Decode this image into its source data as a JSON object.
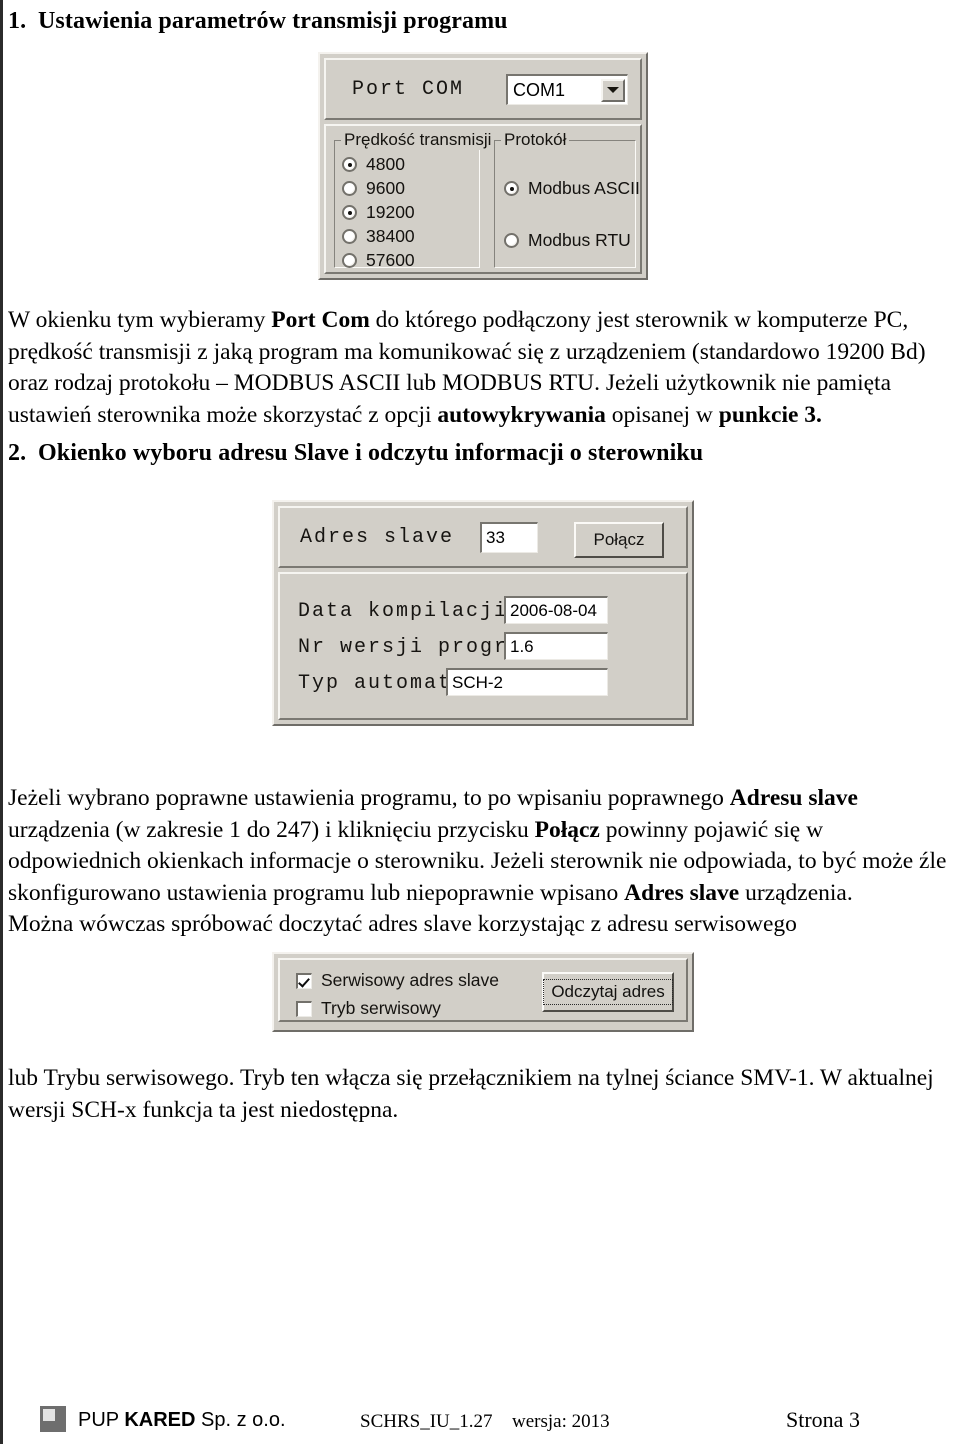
{
  "document": {
    "sections": [
      {
        "number": "1.",
        "title": "Ustawienia parametrów transmisji programu"
      },
      {
        "number": "2.",
        "title": "Okienko wyboru adresu Slave i odczytu informacji o sterowniku"
      }
    ],
    "paragraphs": {
      "p1_l1_a": "W okienku tym wybieramy ",
      "p1_l1_b": "Port Com",
      "p1_l1_c": " do którego podłączony jest sterownik w komputerze PC,",
      "p1_l2": "prędkość transmisji z jaką program ma komunikować się z urządzeniem (standardowo 19200 Bd)",
      "p1_l3": "oraz rodzaj protokołu – MODBUS ASCII lub MODBUS RTU. Jeżeli użytkownik nie pamięta",
      "p1_l4_a": "ustawień sterownika może skorzystać z opcji ",
      "p1_l4_b": "autowykrywania",
      "p1_l4_c": " opisanej w ",
      "p1_l4_d": "punkcie  3.",
      "p2_l1_a": "Jeżeli wybrano poprawne ustawienia programu, to po wpisaniu poprawnego ",
      "p2_l1_b": "Adresu slave",
      "p2_l2_a": "urządzenia (w zakresie 1 do 247) i kliknięciu przycisku ",
      "p2_l2_b": "Połącz",
      "p2_l2_c": " powinny pojawić się w",
      "p2_l3": "odpowiednich okienkach informacje o sterowniku. Jeżeli sterownik nie odpowiada, to być może źle",
      "p2_l4_a": "skonfigurowano ustawienia programu lub niepoprawnie wpisano ",
      "p2_l4_b": "Adres slave",
      "p2_l4_c": " urządzenia.",
      "p2_l5": "Można wówczas spróbować doczytać adres slave korzystając z adresu serwisowego",
      "p3_l1": "lub Trybu serwisowego. Tryb ten włącza się przełącznikiem na tylnej ściance SMV-1. W aktualnej",
      "p3_l2": "wersji SCH-x funkcja ta jest niedostępna."
    }
  },
  "dialog_transmission": {
    "port_label": "Port COM",
    "port_value": "COM1",
    "dropdown_icon": "chevron-down-icon",
    "baud_group": {
      "title": "Prędkość transmisji",
      "options": [
        "4800",
        "9600",
        "19200",
        "38400",
        "57600"
      ],
      "selected": "19200"
    },
    "protocol_group": {
      "title": "Protokół",
      "options": [
        "Modbus ASCII",
        "Modbus RTU"
      ],
      "selected": "Modbus ASCII"
    }
  },
  "dialog_slave": {
    "address_label": "Adres slave",
    "address_value": "33",
    "connect_button": "Połącz",
    "info_fields": [
      {
        "label": "Data kompilacji",
        "value": "2006-08-04"
      },
      {
        "label": "Nr wersji programu",
        "value": "1.6"
      },
      {
        "label": "Typ automatu",
        "value": "SCH-2"
      }
    ]
  },
  "dialog_service": {
    "checkbox_service_address": {
      "label": "Serwisowy adres slave",
      "checked": true
    },
    "checkbox_service_mode": {
      "label": "Tryb serwisowy",
      "checked": false
    },
    "read_address_button": "Odczytaj adres"
  },
  "footer": {
    "logo_icon": "kared-logo-icon",
    "company_prefix": "PUP ",
    "company_bold": "KARED",
    "company_suffix": " Sp. z o.o.",
    "doc_id": "SCHRS_IU_1.27",
    "doc_version": "wersja: 2013",
    "page_label": "Strona 3"
  },
  "colors": {
    "dialog_face": "#d2cfc8",
    "dialog_shadow": "#6f6d68",
    "dialog_highlight": "#f4f2ee",
    "field_bg": "#ffffff",
    "text": "#000000"
  }
}
